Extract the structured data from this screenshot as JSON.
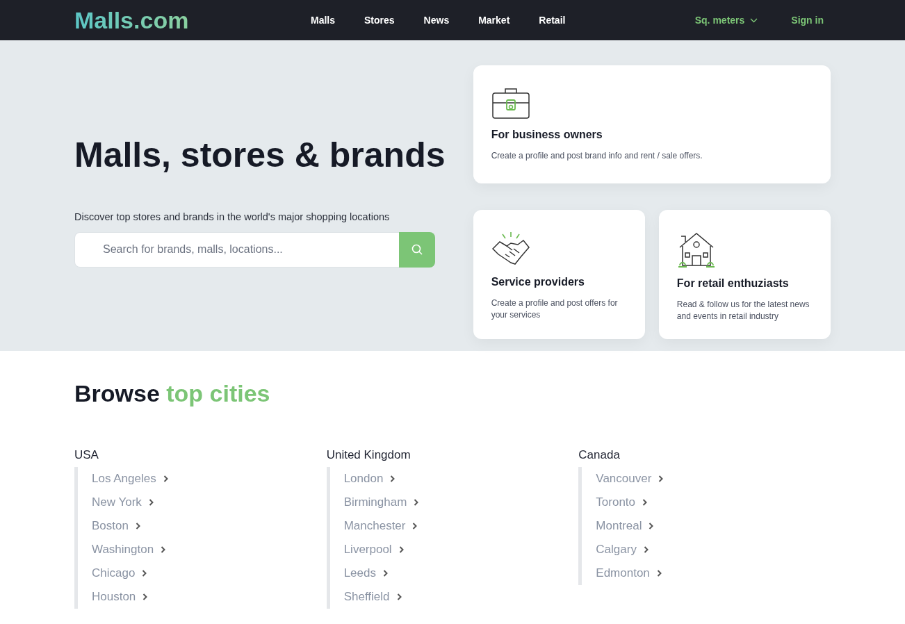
{
  "header": {
    "logo": "Malls.com",
    "nav": [
      "Malls",
      "Stores",
      "News",
      "Market",
      "Retail"
    ],
    "units": "Sq. meters",
    "sign_in": "Sign in"
  },
  "hero": {
    "title": "Malls, stores & brands",
    "subtitle": "Discover top stores and brands in the world's major shopping locations",
    "search": {
      "placeholder": "Search for brands, malls, locations..."
    }
  },
  "cards": [
    {
      "kind": "briefcase",
      "title": "For business owners",
      "text": "Create a profile and post brand info and rent / sale offers."
    },
    {
      "kind": "handshake",
      "title": "Service providers",
      "text": "Create a profile and post offers for your services"
    },
    {
      "kind": "house",
      "title": "For retail enthuziasts",
      "text": "Read & follow us for the latest news and events in retail industry"
    }
  ],
  "browse": {
    "title": "Browse **top cities**",
    "countries": [
      {
        "name": "USA",
        "cities": [
          "Los Angeles",
          "New York",
          "Boston",
          "Washington",
          "Chicago",
          "Houston"
        ]
      },
      {
        "name": "United Kingdom",
        "cities": [
          "London",
          "Birmingham",
          "Manchester",
          "Liverpool",
          "Leeds",
          "Sheffield"
        ]
      },
      {
        "name": "Canada",
        "cities": [
          "Vancouver",
          "Toronto",
          "Montreal",
          "Calgary",
          "Edmonton"
        ]
      }
    ]
  }
}
